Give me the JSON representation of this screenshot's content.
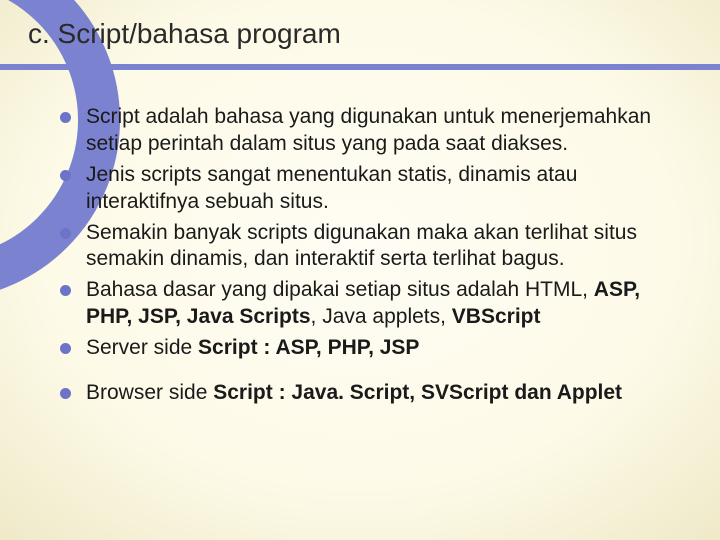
{
  "title": "c. Script/bahasa program",
  "bullets": {
    "b0a": "Script adalah bahasa yang digunakan untuk menerjemahkan setiap perintah dalam situs yang pada saat diakses.",
    "b1a": "Jenis scripts sangat menentukan statis, dinamis atau interaktifnya sebuah situs.",
    "b2a": " Semakin banyak scripts digunakan maka akan terlihat situs semakin dinamis, dan interaktif serta terlihat bagus.",
    "b3a": "Bahasa dasar yang dipakai setiap situs adalah HTML, ",
    "b3b": "ASP, PHP, JSP, Java Scripts",
    "b3c": ", Java applets, ",
    "b3d": "VBScript",
    "b4a": "Server side",
    "b4b": " Script : ASP, PHP, JSP",
    "b5a": "Browser side",
    "b5b": " Script : Java. Script, SVScript dan Applet"
  }
}
